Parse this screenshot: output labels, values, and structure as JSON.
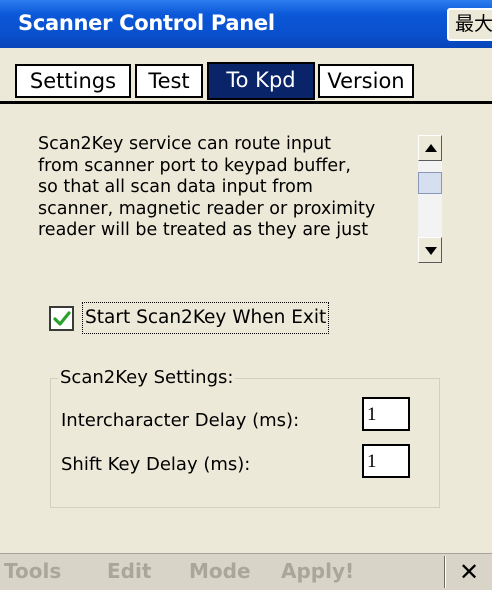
{
  "window": {
    "title": "Scanner Control Panel",
    "title_button_label": "最大"
  },
  "tabs": [
    {
      "label": "Settings",
      "active": false
    },
    {
      "label": "Test",
      "active": false
    },
    {
      "label": "To Kpd",
      "active": true
    },
    {
      "label": "Version",
      "active": false
    }
  ],
  "description": {
    "lines": [
      "Scan2Key service can route input",
      "from scanner port to keypad buffer,",
      "so that all scan data input from",
      "scanner, magnetic reader or proximity",
      "reader will be treated as they are just"
    ]
  },
  "start_on_exit": {
    "label": "Start Scan2Key When Exit",
    "checked": true
  },
  "settings_group": {
    "title": "Scan2Key Settings:",
    "intercharacter_delay": {
      "label": "Intercharacter Delay (ms):",
      "value": "1"
    },
    "shift_key_delay": {
      "label": "Shift Key Delay (ms):",
      "value": "1"
    }
  },
  "menubar": {
    "items": [
      "Tools",
      "Edit",
      "Mode",
      "Apply!"
    ],
    "close_glyph": "✕"
  },
  "colors": {
    "titlebar": "#0a52d2",
    "active_tab": "#0a246a",
    "check": "#2ca02c",
    "disabled_menu_text": "#a9a69a"
  }
}
